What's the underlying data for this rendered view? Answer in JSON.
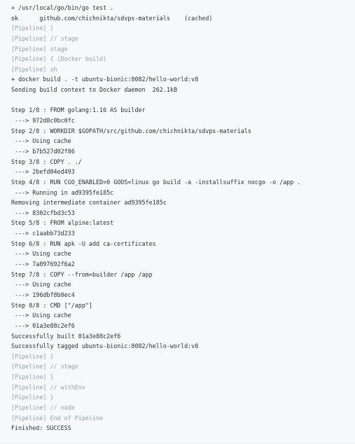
{
  "console_output": {
    "lines": [
      {
        "text": "+ /usr/local/go/bin/go test .",
        "kind": "output"
      },
      {
        "text": "ok      github.com/chichnikta/sdvps-materials    (cached)",
        "kind": "output"
      },
      {
        "text": "[Pipeline] }",
        "kind": "pipeline"
      },
      {
        "text": "[Pipeline] // stage",
        "kind": "pipeline"
      },
      {
        "text": "[Pipeline] stage",
        "kind": "pipeline"
      },
      {
        "text": "[Pipeline] { (Docker build)",
        "kind": "pipeline"
      },
      {
        "text": "[Pipeline] sh",
        "kind": "pipeline"
      },
      {
        "text": "+ docker build . -t ubuntu-bionic:8082/hello-world:v8",
        "kind": "output"
      },
      {
        "text": "Sending build context to Docker daemon  262.1kB",
        "kind": "output"
      },
      {
        "text": "",
        "kind": "output"
      },
      {
        "text": "Step 1/8 : FROM golang:1.16 AS builder",
        "kind": "output"
      },
      {
        "text": " ---> 972d8c0bc0fc",
        "kind": "output"
      },
      {
        "text": "Step 2/8 : WORKDIR $GOPATH/src/github.com/chichnikta/sdvps-materials",
        "kind": "output"
      },
      {
        "text": " ---> Using cache",
        "kind": "output"
      },
      {
        "text": " ---> b7b527d02f86",
        "kind": "output"
      },
      {
        "text": "Step 3/8 : COPY . ./",
        "kind": "output"
      },
      {
        "text": " ---> 2befd04ed493",
        "kind": "output"
      },
      {
        "text": "Step 4/8 : RUN CGO_ENABLED=0 GOOS=linux go build -a -installsuffix nocgo -o /app .",
        "kind": "output"
      },
      {
        "text": " ---> Running in ad9395fe185c",
        "kind": "output"
      },
      {
        "text": "Removing intermediate container ad9395fe185c",
        "kind": "output"
      },
      {
        "text": " ---> 8302cfbd3c53",
        "kind": "output"
      },
      {
        "text": "Step 5/8 : FROM alpine:latest",
        "kind": "output"
      },
      {
        "text": " ---> c1aabb73d233",
        "kind": "output"
      },
      {
        "text": "Step 6/8 : RUN apk -U add ca-certificates",
        "kind": "output"
      },
      {
        "text": " ---> Using cache",
        "kind": "output"
      },
      {
        "text": " ---> 7a097692f6a2",
        "kind": "output"
      },
      {
        "text": "Step 7/8 : COPY --from=builder /app /app",
        "kind": "output"
      },
      {
        "text": " ---> Using cache",
        "kind": "output"
      },
      {
        "text": " ---> 196dbf8b0ec4",
        "kind": "output"
      },
      {
        "text": "Step 8/8 : CMD [\"/app\"]",
        "kind": "output"
      },
      {
        "text": " ---> Using cache",
        "kind": "output"
      },
      {
        "text": " ---> 01a3e88c2ef6",
        "kind": "output"
      },
      {
        "text": "Successfully built 01a3e88c2ef6",
        "kind": "output"
      },
      {
        "text": "Successfully tagged ubuntu-bionic:8082/hello-world:v8",
        "kind": "output"
      },
      {
        "text": "[Pipeline] }",
        "kind": "pipeline"
      },
      {
        "text": "[Pipeline] // stage",
        "kind": "pipeline"
      },
      {
        "text": "[Pipeline] }",
        "kind": "pipeline"
      },
      {
        "text": "[Pipeline] // withEnv",
        "kind": "pipeline"
      },
      {
        "text": "[Pipeline] }",
        "kind": "pipeline"
      },
      {
        "text": "[Pipeline] // node",
        "kind": "pipeline"
      },
      {
        "text": "[Pipeline] End of Pipeline",
        "kind": "pipeline"
      },
      {
        "text": "Finished: SUCCESS",
        "kind": "output"
      }
    ]
  },
  "colors": {
    "background": "#f7f8f9",
    "output_text": "#2d2f33",
    "pipeline_text": "#9aa0a7"
  }
}
